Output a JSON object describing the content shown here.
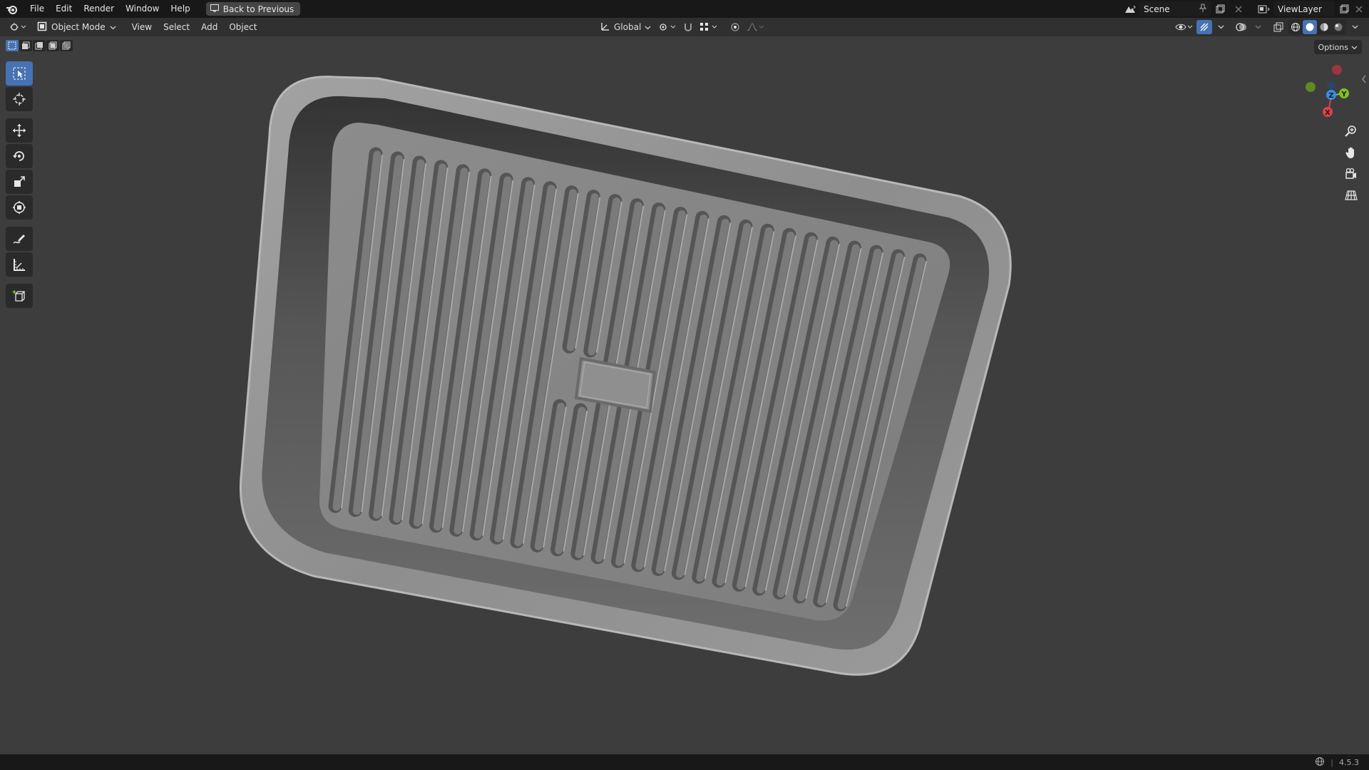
{
  "app": {
    "menus": [
      "File",
      "Edit",
      "Render",
      "Window",
      "Help"
    ],
    "back_button": "Back to Previous",
    "scene_name": "Scene",
    "view_layer": "ViewLayer"
  },
  "header": {
    "mode": "Object Mode",
    "menus": [
      "View",
      "Select",
      "Add",
      "Object"
    ],
    "transform_orientation": "Global",
    "options": "Options"
  },
  "toolbar": {
    "tools": [
      "select-box-icon",
      "cursor-icon",
      "move-icon",
      "rotate-icon",
      "scale-icon",
      "transform-icon",
      "annotate-icon",
      "measure-icon",
      "add-cube-icon"
    ],
    "active_tool": "select-box-icon"
  },
  "gizmo": {
    "axes": [
      "X",
      "Y",
      "Z"
    ],
    "colors": {
      "x": "#e0404f",
      "y": "#82c01e",
      "z": "#3a8ee6"
    }
  },
  "status": {
    "version": "4.5.3"
  },
  "colors": {
    "accent": "#4772b3",
    "viewport_bg": "#3d3d3d",
    "object": "#8a8a8a"
  }
}
